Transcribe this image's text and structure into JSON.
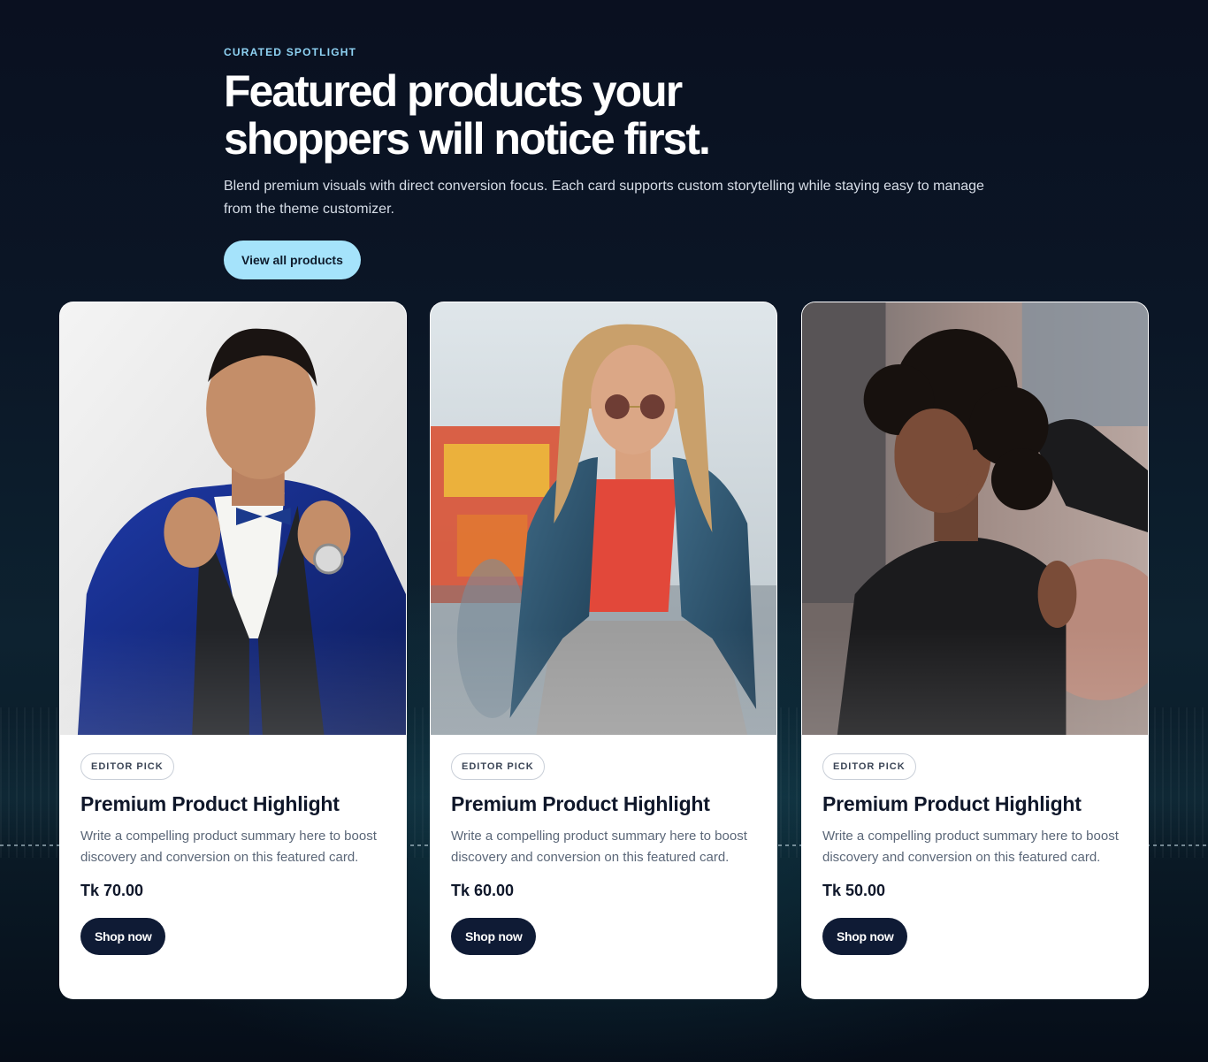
{
  "hero": {
    "eyebrow": "CURATED SPOTLIGHT",
    "headline": "Featured products your shoppers will notice first.",
    "subtext": "Blend premium visuals with direct conversion focus. Each card supports custom storytelling while staying easy to manage from the theme customizer.",
    "cta_label": "View all products"
  },
  "cards": [
    {
      "badge": "EDITOR PICK",
      "title": "Premium Product Highlight",
      "description": "Write a compelling product summary here to boost discovery and conversion on this featured card.",
      "price": "Tk 70.00",
      "button": "Shop now"
    },
    {
      "badge": "EDITOR PICK",
      "title": "Premium Product Highlight",
      "description": "Write a compelling product summary here to boost discovery and conversion on this featured card.",
      "price": "Tk 60.00",
      "button": "Shop now"
    },
    {
      "badge": "EDITOR PICK",
      "title": "Premium Product Highlight",
      "description": "Write a compelling product summary here to boost discovery and conversion on this featured card.",
      "price": "Tk 50.00",
      "button": "Shop now"
    }
  ],
  "colors": {
    "accent": "#a5e3fb",
    "eyebrow": "#8fd3f4",
    "button_dark": "#0f1b35",
    "background": "#0a1020"
  }
}
